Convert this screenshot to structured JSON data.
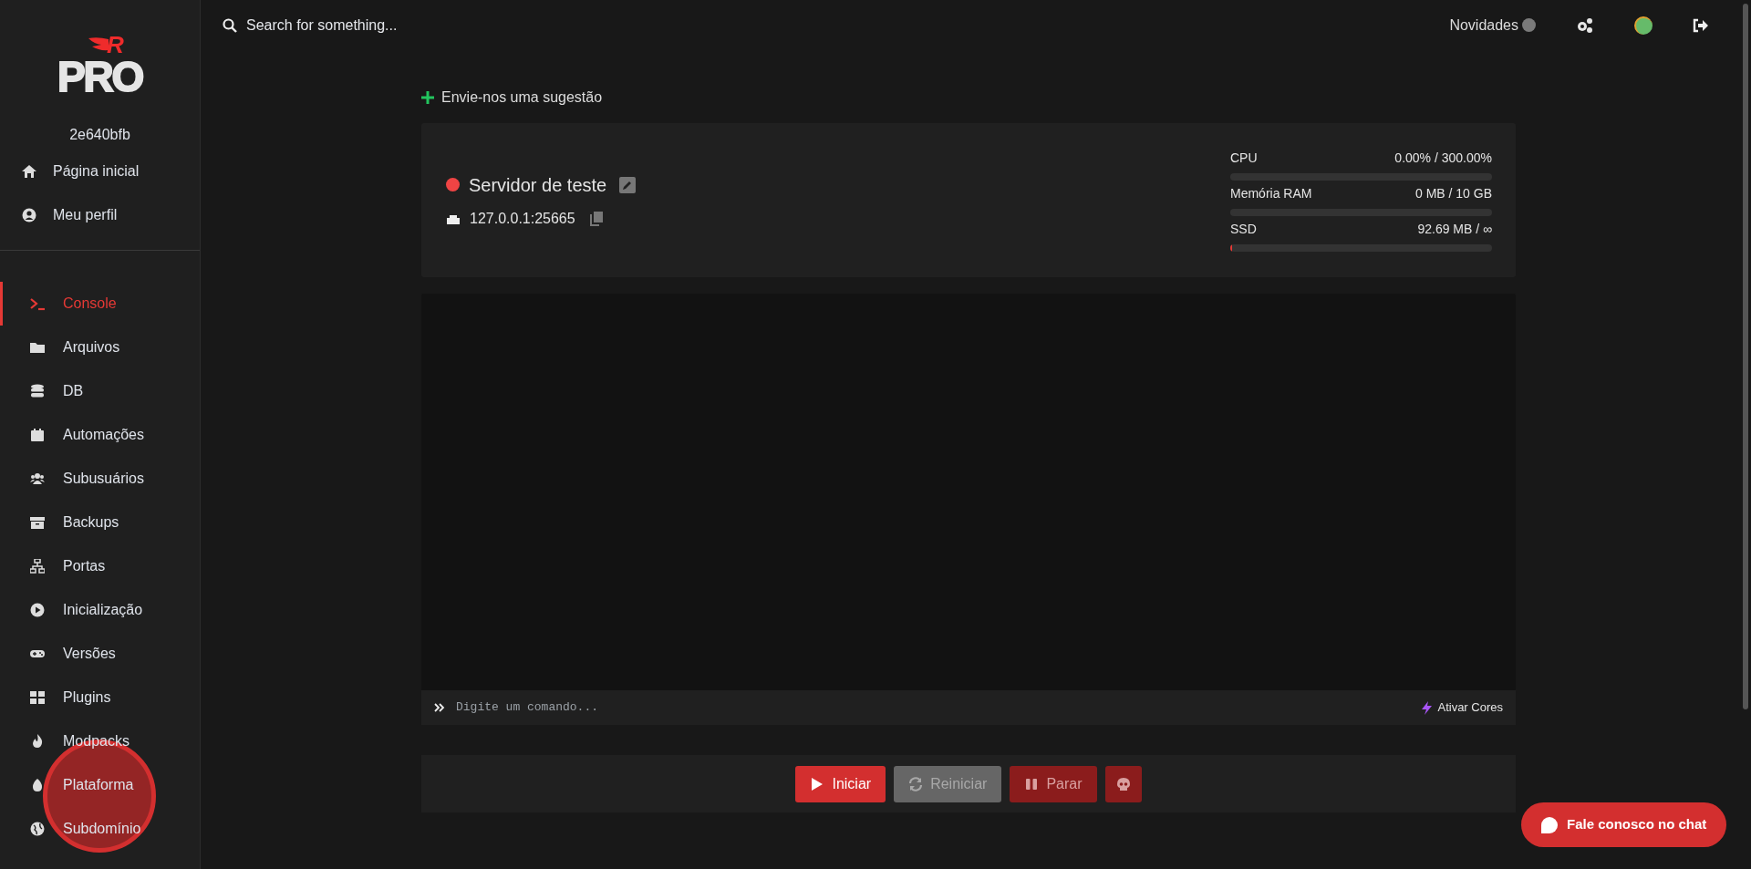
{
  "sidebar": {
    "logo": {
      "text": "PRO",
      "mark": "R"
    },
    "server_id": "2e640bfb",
    "top_items": [
      {
        "label": "Página inicial"
      },
      {
        "label": "Meu perfil"
      }
    ],
    "items": [
      {
        "label": "Console",
        "selected": true
      },
      {
        "label": "Arquivos",
        "selected": false
      },
      {
        "label": "DB",
        "selected": false
      },
      {
        "label": "Automações",
        "selected": false
      },
      {
        "label": "Subusuários",
        "selected": false
      },
      {
        "label": "Backups",
        "selected": false
      },
      {
        "label": "Portas",
        "selected": false
      },
      {
        "label": "Inicialização",
        "selected": false
      },
      {
        "label": "Versões",
        "selected": false
      },
      {
        "label": "Plugins",
        "selected": false
      },
      {
        "label": "Modpacks",
        "selected": false
      },
      {
        "label": "Plataforma",
        "selected": false
      },
      {
        "label": "Subdomínio",
        "selected": false
      }
    ]
  },
  "header": {
    "search_placeholder": "Search for something...",
    "news_label": "Novidades"
  },
  "suggestion_link": "Envie-nos uma sugestão",
  "server": {
    "name": "Servidor de teste",
    "address": "127.0.0.1:25665",
    "stats": [
      {
        "label": "CPU",
        "reading": "0.00% / 300.00%",
        "level": 0
      },
      {
        "label": "Memória RAM",
        "reading": "0 MB / 10 GB",
        "level": 0
      },
      {
        "label": "SSD",
        "reading": "92.69 MB / ∞",
        "level": 0.004
      }
    ]
  },
  "console": {
    "placeholder": "Digite um comando...",
    "colors_button": "Ativar Cores"
  },
  "power_buttons": [
    {
      "kind": "start",
      "label": "Iniciar",
      "disabled": false
    },
    {
      "kind": "restart",
      "label": "Reiniciar",
      "disabled": true
    },
    {
      "kind": "stop",
      "label": "Parar",
      "disabled": true
    },
    {
      "kind": "kill",
      "disabled": true
    }
  ],
  "chat_button": "Fale conosco no chat"
}
